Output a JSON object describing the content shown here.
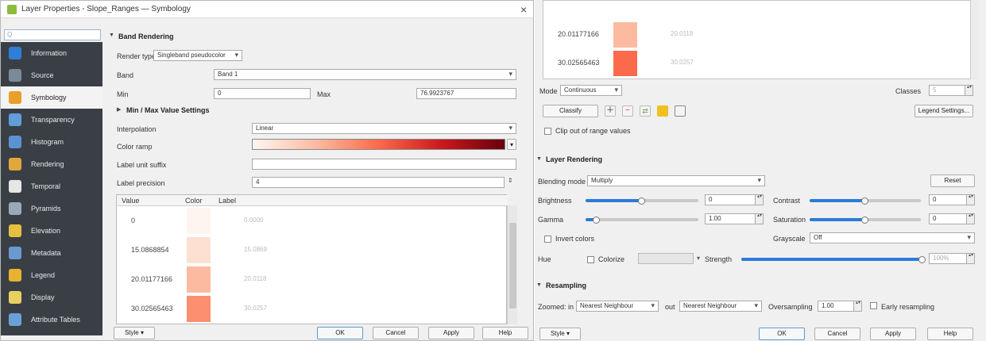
{
  "left_window": {
    "title": "Layer Properties - Slope_Ranges — Symbology",
    "close_glyph": "×",
    "search_placeholder": "Q",
    "sidebar": [
      {
        "label": "Information",
        "icon": "info-icon",
        "color": "#2f7fd6"
      },
      {
        "label": "Source",
        "icon": "settings-icon",
        "color": "#7a8a96"
      },
      {
        "label": "Symbology",
        "icon": "paint-icon",
        "color": "#e8a028"
      },
      {
        "label": "Transparency",
        "icon": "transparency-icon",
        "color": "#5f9ed8"
      },
      {
        "label": "Histogram",
        "icon": "histogram-icon",
        "color": "#5b93d0"
      },
      {
        "label": "Rendering",
        "icon": "rendering-icon",
        "color": "#e1a73a"
      },
      {
        "label": "Temporal",
        "icon": "clock-icon",
        "color": "#e6e6e6"
      },
      {
        "label": "Pyramids",
        "icon": "pyramid-icon",
        "color": "#9aa9b8"
      },
      {
        "label": "Elevation",
        "icon": "elevation-icon",
        "color": "#e5c040"
      },
      {
        "label": "Metadata",
        "icon": "metadata-icon",
        "color": "#6a9ad0"
      },
      {
        "label": "Legend",
        "icon": "legend-icon",
        "color": "#e8b230"
      },
      {
        "label": "Display",
        "icon": "display-icon",
        "color": "#e8d060"
      },
      {
        "label": "Attribute Tables",
        "icon": "table-icon",
        "color": "#6aa0d8"
      }
    ],
    "band_rendering_header": "Band Rendering",
    "render_type_label": "Render type",
    "render_type_value": "Singleband pseudocolor",
    "band_label": "Band",
    "band_value": "Band 1",
    "min_label": "Min",
    "min_value": "0",
    "max_label": "Max",
    "max_value": "76.9923767",
    "minmax_header": "Min / Max Value Settings",
    "interpolation_label": "Interpolation",
    "interpolation_value": "Linear",
    "color_ramp_label": "Color ramp",
    "label_unit_suffix_label": "Label unit suffix",
    "label_precision_label": "Label precision",
    "label_precision_value": "4",
    "table_headers": {
      "value": "Value",
      "color": "Color",
      "label": "Label"
    },
    "classes": [
      {
        "value": "0",
        "label": "0.0000",
        "color": "#fff5f0"
      },
      {
        "value": "15.0868854",
        "label": "15.0869",
        "color": "#fee0d2"
      },
      {
        "value": "20.01177166",
        "label": "20.0118",
        "color": "#fcbba1"
      },
      {
        "value": "30.02565463",
        "label": "30.0257",
        "color": "#fb8f6f"
      }
    ],
    "style_button": "Style",
    "ok_button": "OK",
    "cancel_button": "Cancel",
    "apply_button": "Apply",
    "help_button": "Help"
  },
  "right_window": {
    "classes": [
      {
        "value": "20.01177166",
        "label": "20.0118",
        "color": "#fcbba1"
      },
      {
        "value": "30.02565463",
        "label": "30.0257",
        "color": "#fb6a4a"
      }
    ],
    "mode_label": "Mode",
    "mode_value": "Continuous",
    "classes_label": "Classes",
    "classes_value": "5",
    "classify_button": "Classify",
    "legend_settings_button": "Legend Settings...",
    "clip_label": "Clip out of range values",
    "layer_rendering_header": "Layer Rendering",
    "blending_label": "Blending mode",
    "blending_value": "Multiply",
    "reset_button": "Reset",
    "brightness_label": "Brightness",
    "brightness_value": "0",
    "brightness_level": 0.5,
    "contrast_label": "Contrast",
    "contrast_value": "0",
    "contrast_level": 0.5,
    "gamma_label": "Gamma",
    "gamma_value": "1.00",
    "gamma_level": 0.1,
    "saturation_label": "Saturation",
    "saturation_value": "0",
    "saturation_level": 0.5,
    "invert_label": "Invert colors",
    "grayscale_label": "Grayscale",
    "grayscale_value": "Off",
    "hue_label": "Hue",
    "colorize_label": "Colorize",
    "strength_label": "Strength",
    "strength_value": "100%",
    "strength_level": 1.0,
    "resampling_header": "Resampling",
    "zoomed_in_label": "Zoomed: in",
    "zoomed_in_value": "Nearest Neighbour",
    "out_label": "out",
    "zoomed_out_value": "Nearest Neighbour",
    "oversampling_label": "Oversampling",
    "oversampling_value": "1.00",
    "early_resampling_label": "Early resampling",
    "style_button": "Style",
    "ok_button": "OK",
    "cancel_button": "Cancel",
    "apply_button": "Apply",
    "help_button": "Help"
  },
  "colors": {
    "sidebar_bg": "#3a3f46",
    "accent": "#2c7bd8"
  }
}
